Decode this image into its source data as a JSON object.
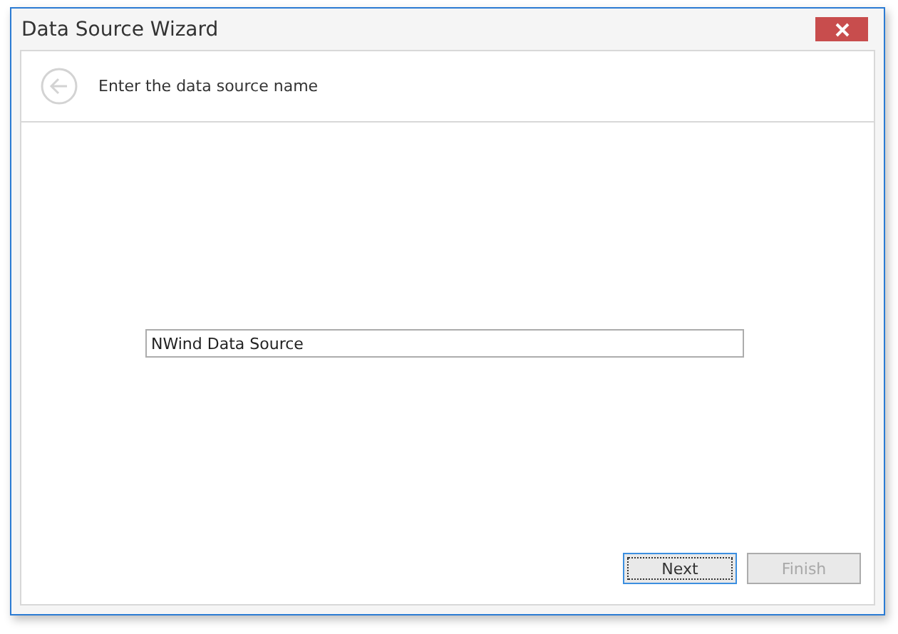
{
  "window": {
    "title": "Data Source Wizard"
  },
  "header": {
    "back_disabled": true,
    "title": "Enter the data source name"
  },
  "name_field": {
    "value": "NWind Data Source"
  },
  "buttons": [
    {
      "label": "Next",
      "focused": true,
      "disabled": false
    },
    {
      "label": "Finish",
      "focused": false,
      "disabled": true
    }
  ]
}
